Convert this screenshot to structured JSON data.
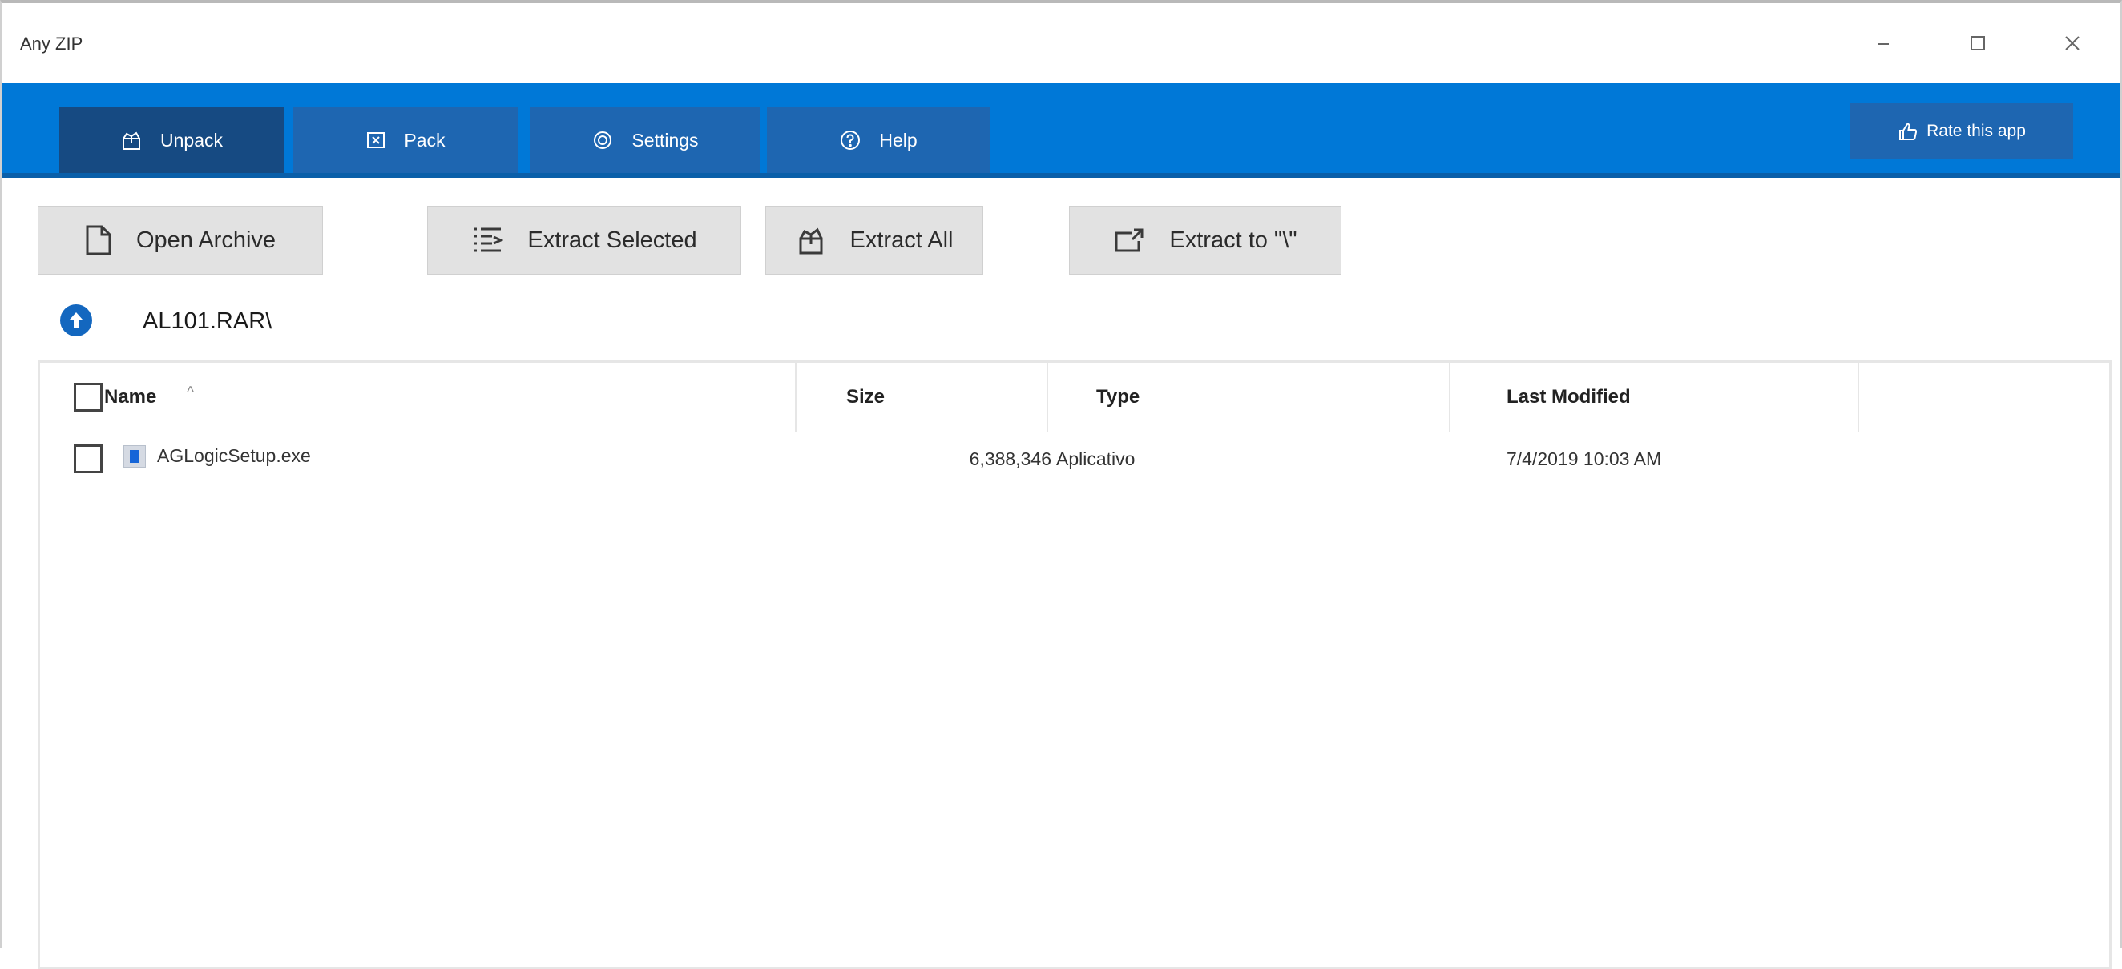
{
  "window": {
    "title": "Any ZIP",
    "controls": {
      "minimize": "minimize",
      "maximize": "maximize",
      "close": "close"
    }
  },
  "nav": {
    "tabs": [
      {
        "label": "Unpack",
        "icon": "unpack-icon",
        "active": true
      },
      {
        "label": "Pack",
        "icon": "pack-icon",
        "active": false
      },
      {
        "label": "Settings",
        "icon": "settings-icon",
        "active": false
      },
      {
        "label": "Help",
        "icon": "help-icon",
        "active": false
      }
    ],
    "rate_label": "Rate this app"
  },
  "toolbar": {
    "open_archive": "Open Archive",
    "extract_selected": "Extract Selected",
    "extract_all": "Extract All",
    "extract_to": "Extract to \"\\\""
  },
  "path": {
    "current": "AL101.RAR\\"
  },
  "filelist": {
    "columns": {
      "name": "Name",
      "size": "Size",
      "type": "Type",
      "modified": "Last Modified"
    },
    "sort_indicator": "^",
    "rows": [
      {
        "name": "AGLogicSetup.exe",
        "size": "6,388,346",
        "type": "Aplicativo",
        "modified": "7/4/2019 10:03 AM"
      }
    ]
  },
  "colors": {
    "accent": "#0078d7",
    "tab": "#1e66b1",
    "tab_active": "#164a82",
    "toolbar_button": "#e2e2e2"
  }
}
